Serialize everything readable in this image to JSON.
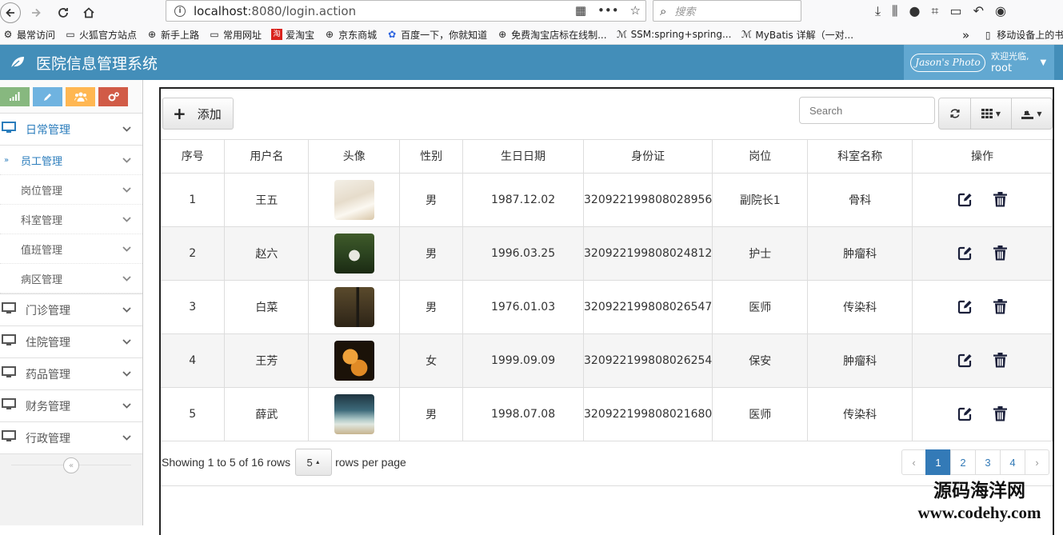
{
  "browser": {
    "url_host": "localhost",
    "url_rest": ":8080/login.action",
    "search_placeholder": "搜索",
    "bookmarks": [
      {
        "label": "最常访问",
        "icon": "gear-icon"
      },
      {
        "label": "火狐官方站点",
        "icon": "folder-icon"
      },
      {
        "label": "新手上路",
        "icon": "globe-icon"
      },
      {
        "label": "常用网址",
        "icon": "folder-icon"
      },
      {
        "label": "爱淘宝",
        "icon": "taobao-icon"
      },
      {
        "label": "京东商城",
        "icon": "globe-icon"
      },
      {
        "label": "百度一下，你就知道",
        "icon": "baidu-icon"
      },
      {
        "label": "免费淘宝店标在线制...",
        "icon": "globe-icon"
      },
      {
        "label": "SSM:spring+spring...",
        "icon": "mybatis-icon"
      },
      {
        "label": "MyBatis 详解（一对...",
        "icon": "mybatis-icon"
      }
    ],
    "mobile_bookmarks": "移动设备上的书"
  },
  "app": {
    "title": "医院信息管理系统",
    "user_badge": "Jason's Photo",
    "welcome": "欢迎光临,",
    "username": "root",
    "header_color": "#438eb9"
  },
  "sidebar": {
    "menus": [
      {
        "label": "日常管理",
        "active": true,
        "submenu": [
          {
            "label": "员工管理",
            "active": true
          },
          {
            "label": "岗位管理"
          },
          {
            "label": "科室管理"
          },
          {
            "label": "值班管理"
          },
          {
            "label": "病区管理"
          }
        ]
      },
      {
        "label": "门诊管理"
      },
      {
        "label": "住院管理"
      },
      {
        "label": "药品管理"
      },
      {
        "label": "财务管理"
      },
      {
        "label": "行政管理"
      }
    ]
  },
  "toolbar": {
    "add_label": "添加",
    "search_placeholder": "Search"
  },
  "table": {
    "headers": [
      "序号",
      "用户名",
      "头像",
      "性别",
      "生日日期",
      "身份证",
      "岗位",
      "科室名称",
      "操作"
    ],
    "rows": [
      {
        "no": "1",
        "name": "王五",
        "avatar": "puppy",
        "sex": "男",
        "birthday": "1987.12.02",
        "id_card": "320922199808028956",
        "post": "副院长1",
        "dept": "骨科"
      },
      {
        "no": "2",
        "name": "赵六",
        "avatar": "couple",
        "sex": "男",
        "birthday": "1996.03.25",
        "id_card": "320922199808024812",
        "post": "护士",
        "dept": "肿瘤科"
      },
      {
        "no": "3",
        "name": "白菜",
        "avatar": "figure",
        "sex": "男",
        "birthday": "1976.01.03",
        "id_card": "320922199808026547",
        "post": "医师",
        "dept": "传染科"
      },
      {
        "no": "4",
        "name": "王芳",
        "avatar": "kittens",
        "sex": "女",
        "birthday": "1999.09.09",
        "id_card": "320922199808026254",
        "post": "保安",
        "dept": "肿瘤科"
      },
      {
        "no": "5",
        "name": "薛武",
        "avatar": "beach",
        "sex": "男",
        "birthday": "1998.07.08",
        "id_card": "320922199808021680",
        "post": "医师",
        "dept": "传染科"
      }
    ]
  },
  "pagination": {
    "showing_text": "Showing 1 to 5 of 16 rows",
    "page_size": "5",
    "per_page_text": "rows per page",
    "prev": "‹",
    "pages": [
      "1",
      "2",
      "3",
      "4"
    ],
    "next": "›",
    "active_page": "1"
  },
  "watermark": {
    "line1": "源码海洋网",
    "line2": "www.codehy.com"
  }
}
